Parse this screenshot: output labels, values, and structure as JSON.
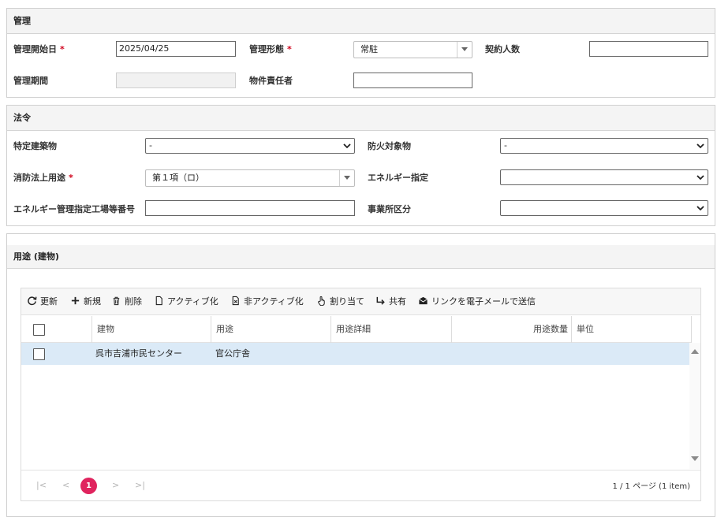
{
  "management": {
    "title": "管理",
    "start_date_label": "管理開始日",
    "start_date_value": "2025/04/25",
    "form_label": "管理形態",
    "form_value": "常駐",
    "contract_count_label": "契約人数",
    "contract_count_value": "",
    "period_label": "管理期間",
    "period_value": "",
    "person_label": "物件責任者",
    "person_value": ""
  },
  "law": {
    "title": "法令",
    "specific_building_label": "特定建築物",
    "specific_building_value": "-",
    "fire_target_label": "防火対象物",
    "fire_target_value": "-",
    "fire_use_label": "消防法上用途",
    "fire_use_value": "第１項（ロ）",
    "energy_label": "エネルギー指定",
    "energy_value": "",
    "energy_factory_label": "エネルギー管理指定工場等番号",
    "energy_factory_value": "",
    "office_class_label": "事業所区分",
    "office_class_value": ""
  },
  "required_mark": "*",
  "usage": {
    "title": "用途 (建物)",
    "toolbar": {
      "refresh": "更新",
      "new": "新規",
      "delete": "削除",
      "activate": "アクティブ化",
      "deactivate": "非アクティブ化",
      "assign": "割り当て",
      "share": "共有",
      "email_link": "リンクを電子メールで送信"
    },
    "columns": [
      "建物",
      "用途",
      "用途詳細",
      "用途数量",
      "単位"
    ],
    "rows": [
      {
        "building": "呉市吉浦市民センター",
        "use": "官公庁舎",
        "detail": "",
        "quantity": "",
        "unit": ""
      }
    ],
    "pager": {
      "first": "|<",
      "prev": "<",
      "current_page": "1",
      "next": ">",
      "last": ">|",
      "summary": "1 / 1 ページ (1 item)"
    }
  },
  "colors": {
    "accent": "#e0245e",
    "row_selected": "#dbeaf7",
    "required": "#d0021b"
  }
}
